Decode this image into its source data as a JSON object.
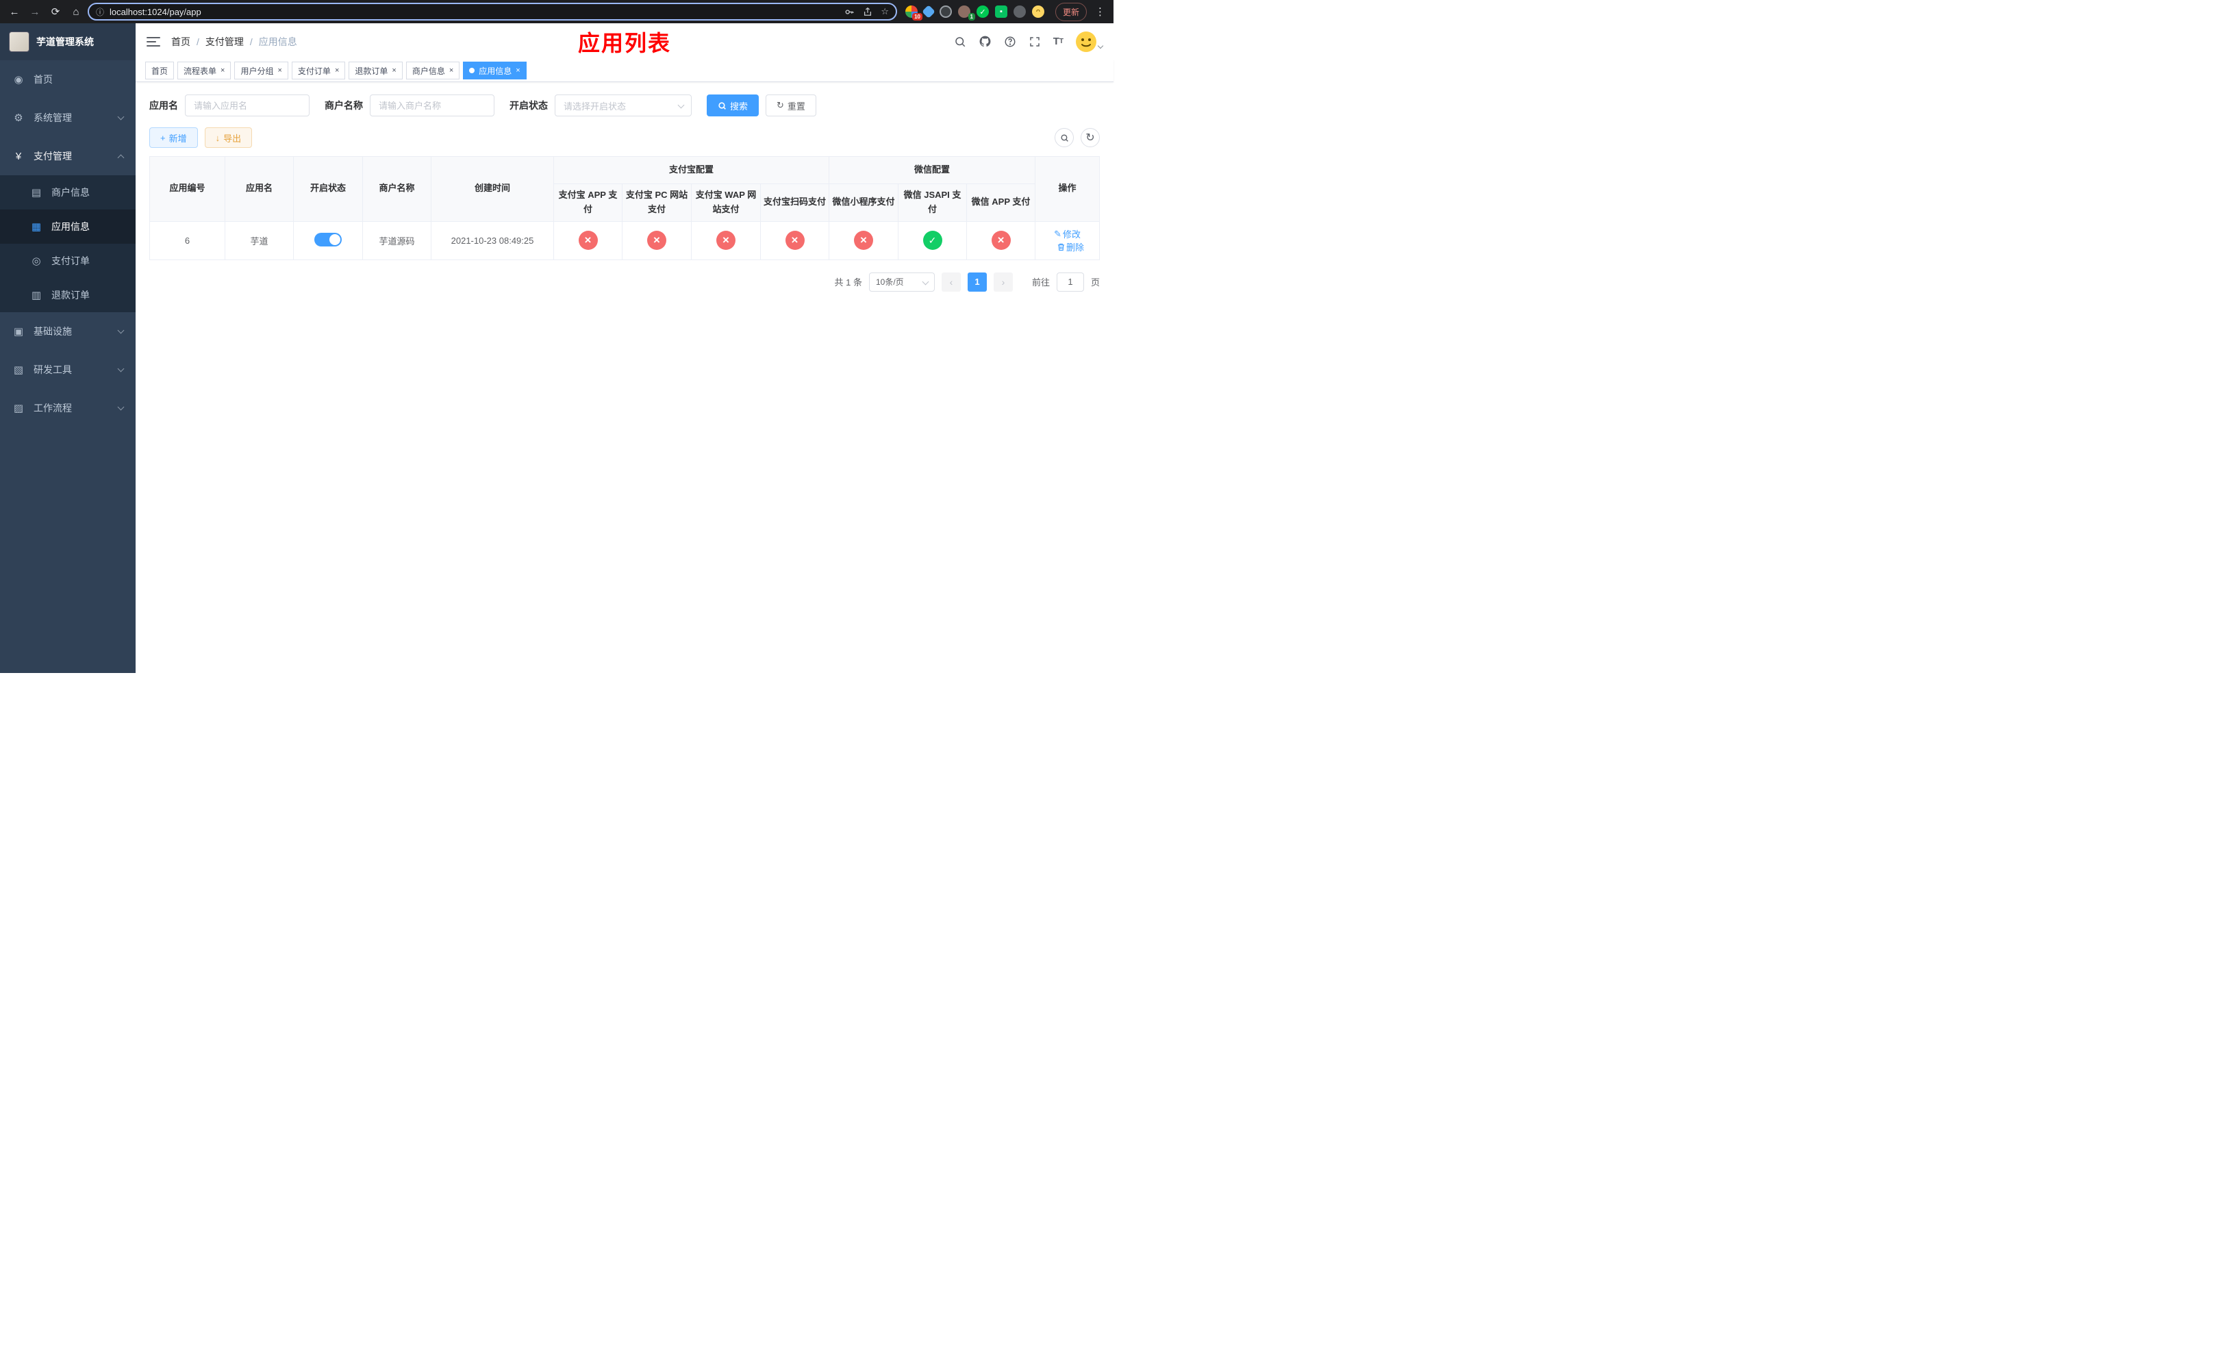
{
  "colors": {
    "primary": "#409eff",
    "success": "#13ce66",
    "danger": "#f56c6c",
    "warning": "#e6a23c",
    "title-red": "#ff0000"
  },
  "browser": {
    "url": "localhost:1024/pay/app",
    "update_label": "更新",
    "ext_badge_1": "10",
    "ext_badge_2": "1"
  },
  "sidebar": {
    "app_title": "芋道管理系统",
    "items": [
      {
        "label": "首页"
      },
      {
        "label": "系统管理"
      },
      {
        "label": "支付管理",
        "children": [
          {
            "label": "商户信息"
          },
          {
            "label": "应用信息",
            "active": true
          },
          {
            "label": "支付订单"
          },
          {
            "label": "退款订单"
          }
        ]
      },
      {
        "label": "基础设施"
      },
      {
        "label": "研发工具"
      },
      {
        "label": "工作流程"
      }
    ]
  },
  "header": {
    "breadcrumb": [
      "首页",
      "支付管理",
      "应用信息"
    ],
    "title": "应用列表"
  },
  "tabs": [
    {
      "label": "首页"
    },
    {
      "label": "流程表单"
    },
    {
      "label": "用户分组"
    },
    {
      "label": "支付订单"
    },
    {
      "label": "退款订单"
    },
    {
      "label": "商户信息"
    },
    {
      "label": "应用信息",
      "active": true
    }
  ],
  "filters": {
    "app_name_label": "应用名",
    "app_name_placeholder": "请输入应用名",
    "merchant_label": "商户名称",
    "merchant_placeholder": "请输入商户名称",
    "status_label": "开启状态",
    "status_placeholder": "请选择开启状态",
    "search_label": "搜索",
    "reset_label": "重置"
  },
  "toolbar": {
    "add_label": "新增",
    "export_label": "导出"
  },
  "table": {
    "col_id": "应用编号",
    "col_name": "应用名",
    "col_status": "开启状态",
    "col_merchant": "商户名称",
    "col_created": "创建时间",
    "group_alipay": "支付宝配置",
    "group_wechat": "微信配置",
    "col_alipay_app": "支付宝 APP 支付",
    "col_alipay_pc": "支付宝 PC 网站支付",
    "col_alipay_wap": "支付宝 WAP 网站支付",
    "col_alipay_qr": "支付宝扫码支付",
    "col_wx_mini": "微信小程序支付",
    "col_wx_jsapi": "微信 JSAPI 支付",
    "col_wx_app": "微信 APP 支付",
    "col_ops": "操作",
    "rows": [
      {
        "id": "6",
        "name": "芋道",
        "enabled": true,
        "merchant": "芋道源码",
        "created": "2021-10-23 08:49:25",
        "alipay_app": false,
        "alipay_pc": false,
        "alipay_wap": false,
        "alipay_qr": false,
        "wx_mini": false,
        "wx_jsapi": true,
        "wx_app": false,
        "edit_label": "修改",
        "delete_label": "删除"
      }
    ]
  },
  "pagination": {
    "total_text": "共 1 条",
    "page_size": "10条/页",
    "page": "1",
    "goto_label": "前往",
    "goto_value": "1",
    "unit_label": "页"
  },
  "icons": {
    "back": "←",
    "forward": "→",
    "reload": "⟳",
    "home": "⌂",
    "info": "ⓘ",
    "star": "☆",
    "overflow": "⋮",
    "plus": "+",
    "download": "↓",
    "reset": "↻",
    "edit": "✎",
    "dashboard": "◉",
    "gear": "⚙",
    "yen": "¥",
    "merchant": "▤",
    "app-grid": "▦",
    "pay-order": "◎",
    "refund-order": "▥",
    "infra": "▣",
    "devtools": "▧",
    "workflow": "▨"
  }
}
